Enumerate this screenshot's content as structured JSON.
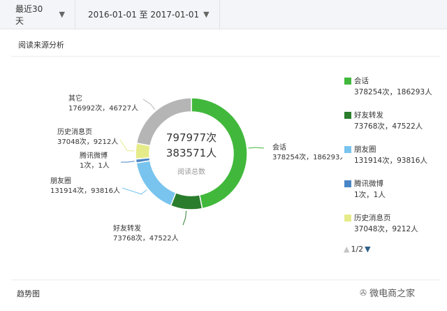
{
  "filters": {
    "period": "最近30天",
    "date_range": "2016-01-01 至 2017-01-01"
  },
  "section_title": "阅读来源分析",
  "bottom_title": "趋势图",
  "pager": "1/2",
  "watermark": "微电商之家",
  "chart_data": {
    "type": "pie",
    "donut": true,
    "center": {
      "total_reads": "797977次",
      "total_users": "383571人",
      "label": "阅读总数"
    },
    "slices": [
      {
        "name": "会话",
        "reads": 378254,
        "users": 186293,
        "text": "378254次，186293人",
        "color": "#41b83c"
      },
      {
        "name": "好友转发",
        "reads": 73768,
        "users": 47522,
        "text": "73768次，47522人",
        "color": "#2a7d2c"
      },
      {
        "name": "朋友圈",
        "reads": 131914,
        "users": 93816,
        "text": "131914次，93816人",
        "color": "#79c4ee"
      },
      {
        "name": "腾讯微博",
        "reads": 1,
        "users": 1,
        "text": "1次，1人",
        "color": "#4a86c6"
      },
      {
        "name": "历史消息页",
        "reads": 37048,
        "users": 9212,
        "text": "37048次，9212人",
        "color": "#e6eb8a"
      },
      {
        "name": "其它",
        "reads": 176992,
        "users": 46727,
        "text": "176992次，46727人",
        "color": "#b5b5b5"
      }
    ]
  },
  "legend_visible_count": 5
}
